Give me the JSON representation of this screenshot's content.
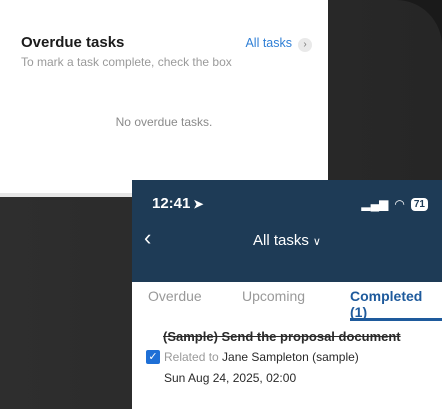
{
  "overdue_card": {
    "title": "Overdue tasks",
    "subtitle": "To mark a task complete, check the box",
    "all_link": "All tasks",
    "empty_message": "No overdue tasks."
  },
  "status_bar": {
    "time": "12:41",
    "battery": "71"
  },
  "nav": {
    "title": "All tasks"
  },
  "tabs": [
    {
      "label": "Overdue"
    },
    {
      "label": "Upcoming"
    },
    {
      "label": "Completed (1)"
    }
  ],
  "task": {
    "name": "(Sample) Send the proposal document",
    "related_prefix": "Related to",
    "related_to": "Jane Sampleton (sample)",
    "due": "Sun Aug 24, 2025, 02:00",
    "completed": true
  },
  "colors": {
    "header_bg": "#1e3b56",
    "accent": "#1e5a9c",
    "link": "#2f7fd6",
    "checkbox": "#1e6fd6"
  }
}
